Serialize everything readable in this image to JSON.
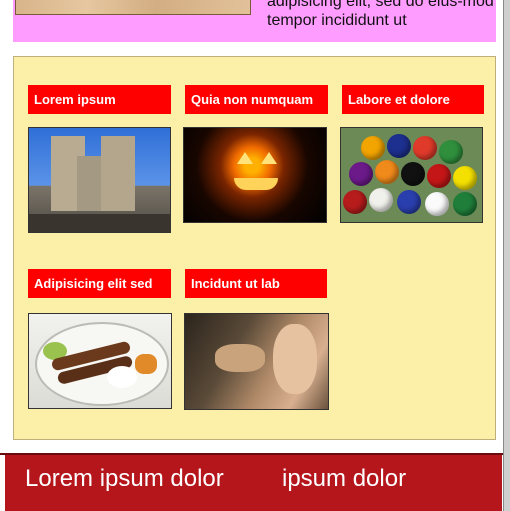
{
  "top": {
    "text": "adipisicing elit, sed do eius-mod tempor incididunt ut"
  },
  "gallery": {
    "tiles": [
      {
        "title": "Lorem ipsum"
      },
      {
        "title": "Quia non numquam"
      },
      {
        "title": "Labore et dolore"
      },
      {
        "title": "Adipisicing elit sed"
      },
      {
        "title": "Incidunt ut lab"
      }
    ]
  },
  "bottom": {
    "left": "Lorem ipsum dolor",
    "right": "ipsum dolor"
  },
  "colors": {
    "tile_title_bg": "#ff0000",
    "gallery_bg": "#fcf0a8",
    "top_band_bg": "#ff9cff",
    "bottom_band_bg": "#b5161c"
  }
}
